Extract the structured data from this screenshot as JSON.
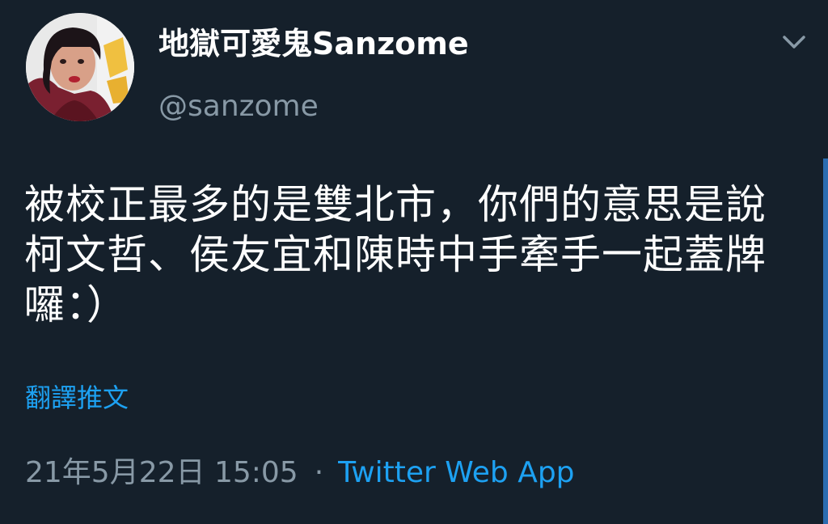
{
  "user": {
    "display_name": "地獄可愛鬼Sanzome",
    "handle": "@sanzome"
  },
  "tweet": {
    "text": "被校正最多的是雙北市，你們的意思是說柯文哲、侯友宜和陳時中手牽手一起蓋牌囉：）",
    "translate_label": "翻譯推文",
    "timestamp": "21年5月22日 15:05",
    "separator": "·",
    "source": "Twitter Web App"
  },
  "icons": {
    "menu": "chevron-down-icon",
    "avatar": "avatar"
  },
  "colors": {
    "background": "#15202b",
    "primary_text": "#ffffff",
    "secondary_text": "#8899a6",
    "link": "#1da1f2"
  }
}
